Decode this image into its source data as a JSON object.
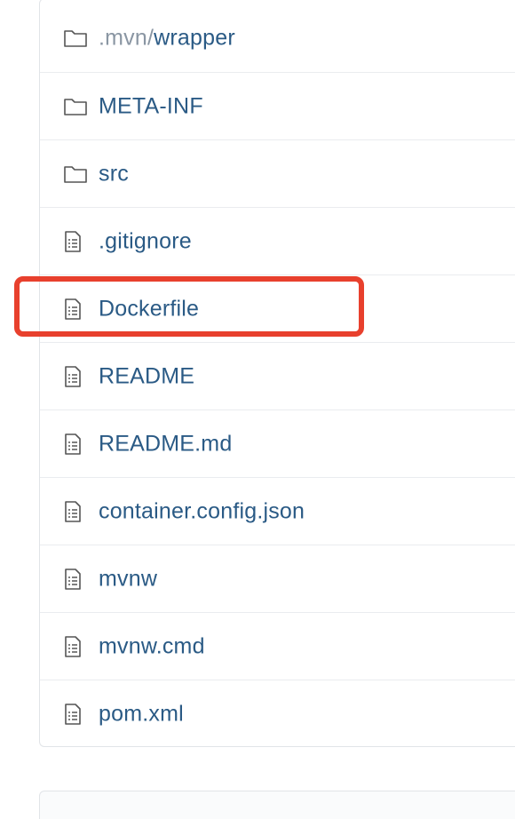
{
  "files": [
    {
      "type": "folder",
      "prefix": ".mvn/",
      "name": "wrapper"
    },
    {
      "type": "folder",
      "prefix": "",
      "name": "META-INF"
    },
    {
      "type": "folder",
      "prefix": "",
      "name": "src"
    },
    {
      "type": "file",
      "prefix": "",
      "name": ".gitignore"
    },
    {
      "type": "file",
      "prefix": "",
      "name": "Dockerfile"
    },
    {
      "type": "file",
      "prefix": "",
      "name": "README"
    },
    {
      "type": "file",
      "prefix": "",
      "name": "README.md"
    },
    {
      "type": "file",
      "prefix": "",
      "name": "container.config.json"
    },
    {
      "type": "file",
      "prefix": "",
      "name": "mvnw"
    },
    {
      "type": "file",
      "prefix": "",
      "name": "mvnw.cmd"
    },
    {
      "type": "file",
      "prefix": "",
      "name": "pom.xml"
    }
  ],
  "highlighted_file": "Dockerfile",
  "colors": {
    "link": "#2a5a85",
    "muted_prefix": "#8a96a3",
    "highlight": "#e8402d",
    "border": "#e1e4e8"
  }
}
